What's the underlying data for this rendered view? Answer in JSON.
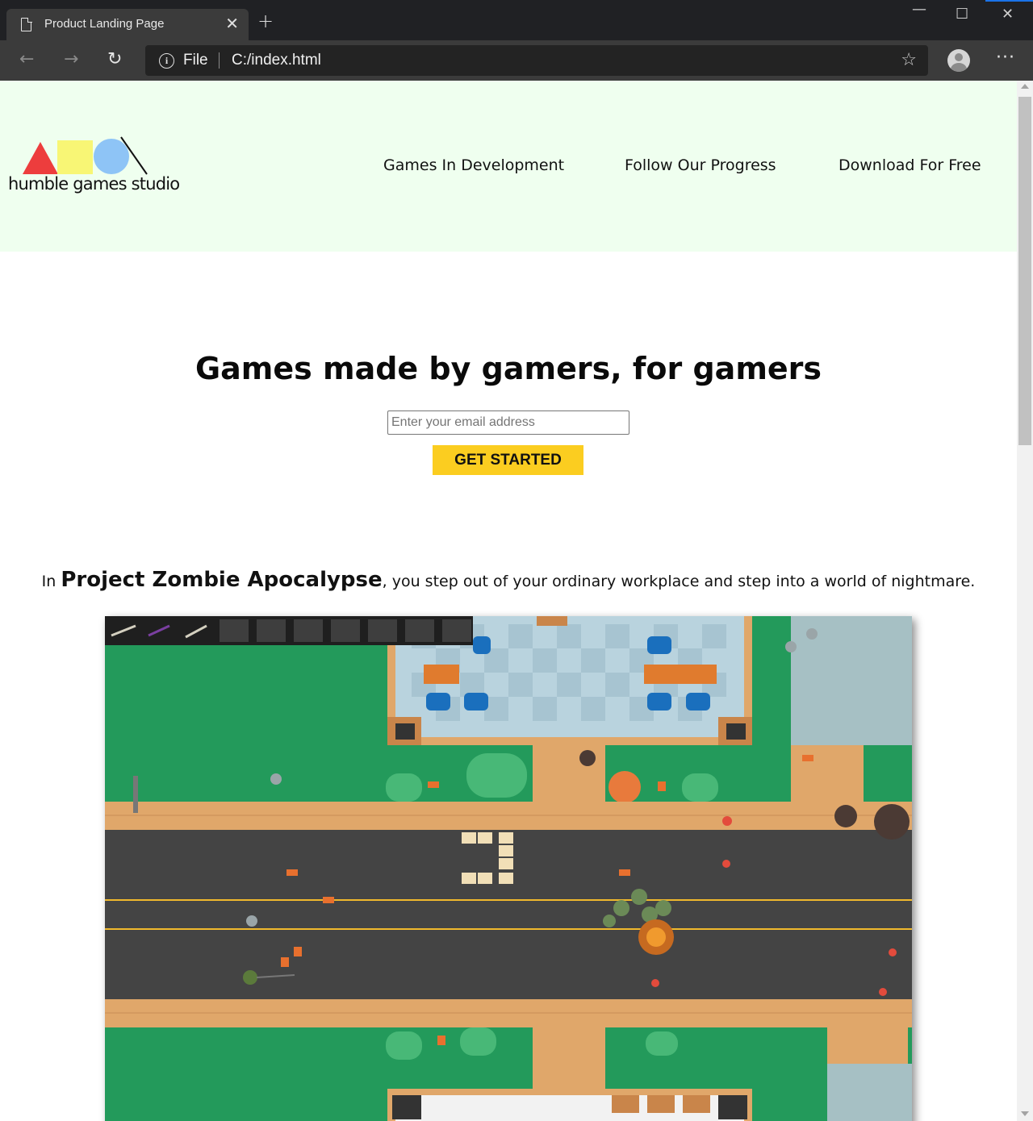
{
  "browser": {
    "tab_title": "Product Landing Page",
    "tab_close": "✕",
    "new_tab": "+",
    "address_scheme": "File",
    "address_url": "C:/index.html",
    "menu_glyph": "···"
  },
  "header": {
    "logo_text": "humble games studio",
    "nav": [
      {
        "label": "Games In Development"
      },
      {
        "label": "Follow Our Progress"
      },
      {
        "label": "Download For Free"
      }
    ]
  },
  "hero": {
    "title": "Games made by gamers, for gamers",
    "email_placeholder": "Enter your email address",
    "cta_label": "GET STARTED",
    "cta_color": "#fbcd20"
  },
  "intro": {
    "prefix": "In ",
    "game_name": "Project Zombie Apocalypse",
    "suffix": ", you step out of your ordinary workplace and step into a world of nightmare."
  },
  "colors": {
    "header_bg": "#efffef",
    "grass": "#239a5b",
    "road": "#444444",
    "sidewalk": "#e0a76a"
  }
}
